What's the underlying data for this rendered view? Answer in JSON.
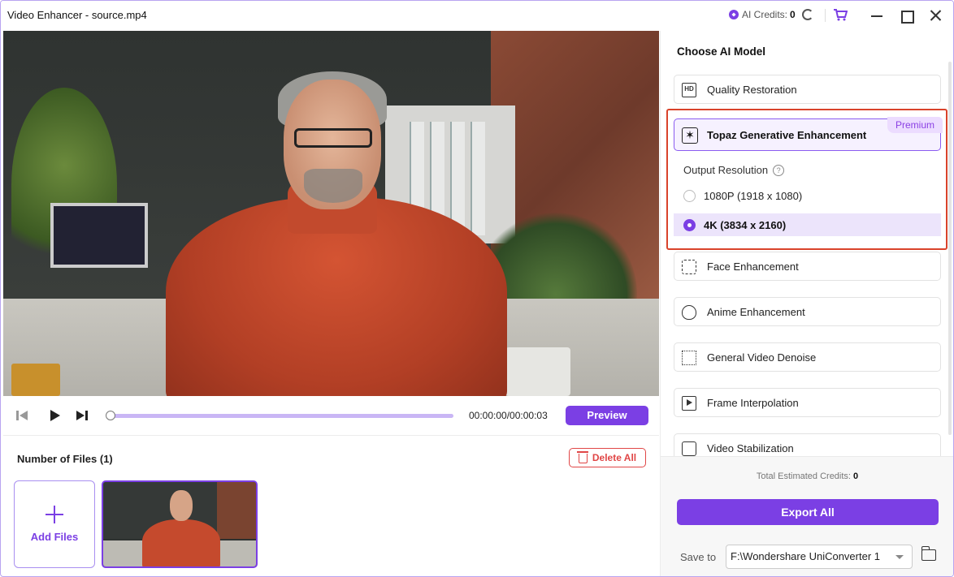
{
  "window": {
    "title": "Video Enhancer - source.mp4"
  },
  "header": {
    "credits_label": "AI Credits:",
    "credits_value": "0"
  },
  "player": {
    "timecode": "00:00:00/00:00:03",
    "preview_label": "Preview",
    "progress": 0
  },
  "files": {
    "title": "Number of Files",
    "count": "(1)",
    "delete_label": "Delete All",
    "add_label": "Add Files"
  },
  "panel": {
    "title": "Choose AI Model",
    "models": [
      {
        "label": "Quality Restoration",
        "icon": "hd-icon"
      },
      {
        "label": "Topaz Generative Enhancement",
        "icon": "sparkle-icon",
        "badge": "Premium",
        "selected": true
      },
      {
        "label": "Face Enhancement",
        "icon": "face-icon"
      },
      {
        "label": "Anime Enhancement",
        "icon": "anime-icon"
      },
      {
        "label": "General Video Denoise",
        "icon": "denoise-icon"
      },
      {
        "label": "Frame Interpolation",
        "icon": "frame-interpolation-icon"
      },
      {
        "label": "Video Stabilization",
        "icon": "stabilization-icon"
      }
    ],
    "output_resolution_label": "Output Resolution",
    "resolutions": [
      {
        "label": "1080P (1918 x 1080)",
        "selected": false
      },
      {
        "label": "4K (3834 x 2160)",
        "selected": true
      }
    ],
    "estimated_label": "Total Estimated Credits:",
    "estimated_value": "0",
    "export_label": "Export All",
    "save_to_label": "Save to",
    "save_path": "F:\\Wondershare UniConverter 1"
  },
  "colors": {
    "accent": "#7b3fe4",
    "danger": "#e04646",
    "highlight_outline": "#d9432b"
  }
}
